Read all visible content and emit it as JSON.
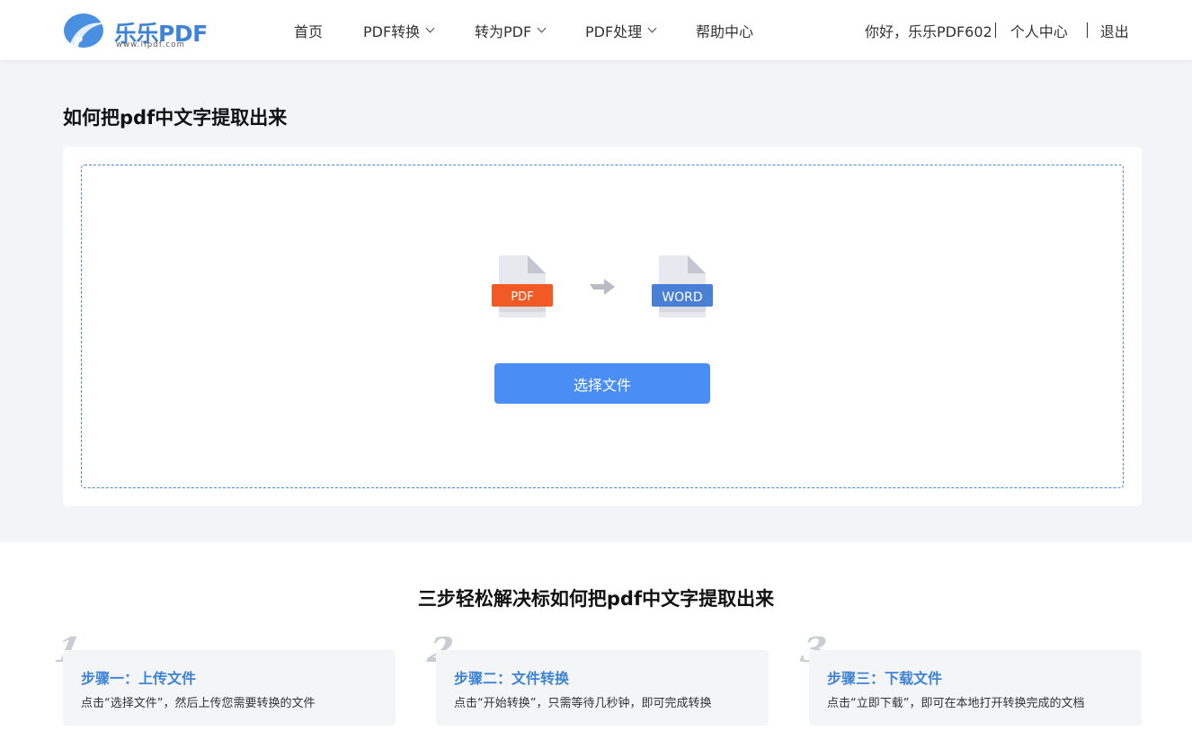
{
  "header": {
    "logo": {
      "text": "乐乐PDF",
      "url": "www.llpdf.com",
      "icon": "pdf-logo-icon"
    },
    "nav": [
      {
        "label": "首页",
        "has_dropdown": false
      },
      {
        "label": "PDF转换",
        "has_dropdown": true
      },
      {
        "label": "转为PDF",
        "has_dropdown": true
      },
      {
        "label": "PDF处理",
        "has_dropdown": true
      },
      {
        "label": "帮助中心",
        "has_dropdown": false
      }
    ],
    "user": {
      "greeting": "你好，乐乐PDF602",
      "center": "个人中心",
      "logout": "退出"
    }
  },
  "main": {
    "title": "如何把pdf中文字提取出来",
    "converter": {
      "from_label": "PDF",
      "to_label": "WORD",
      "from_color": "#f15a24",
      "to_color": "#4a7fd6",
      "select_button": "选择文件"
    }
  },
  "steps": {
    "title": "三步轻松解决标如何把pdf中文字提取出来",
    "items": [
      {
        "num": "1",
        "title": "步骤一：上传文件",
        "desc": "点击“选择文件”，然后上传您需要转换的文件"
      },
      {
        "num": "2",
        "title": "步骤二：文件转换",
        "desc": "点击“开始转换”，只需等待几秒钟，即可完成转换"
      },
      {
        "num": "3",
        "title": "步骤三：下载文件",
        "desc": "点击“立即下载”，即可在本地打开转换完成的文档"
      }
    ]
  },
  "colors": {
    "accent": "#4a8ef5",
    "brand": "#3f83d6",
    "background": "#f3f4f7"
  }
}
